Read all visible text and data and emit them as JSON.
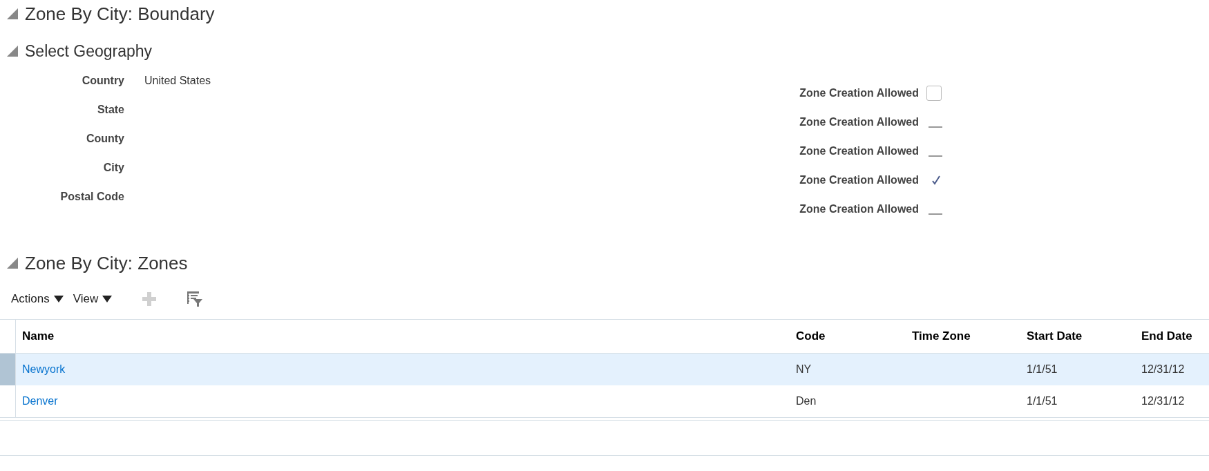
{
  "sections": [
    {
      "title": "Zone By City: Boundary",
      "expanded": true
    },
    {
      "title": "Select Geography",
      "expanded": true
    },
    {
      "title": "Zone By City: Zones",
      "expanded": true
    }
  ],
  "geography": {
    "fields": [
      {
        "label": "Country",
        "value": "United States"
      },
      {
        "label": "State"
      },
      {
        "label": "County"
      },
      {
        "label": "City"
      },
      {
        "label": "Postal Code"
      }
    ],
    "zone_flags": [
      {
        "label": "Zone Creation Allowed",
        "kind": "checkbox",
        "checked": false
      },
      {
        "label": "Zone Creation Allowed",
        "kind": "readonly",
        "checked": false
      },
      {
        "label": "Zone Creation Allowed",
        "kind": "readonly",
        "checked": false
      },
      {
        "label": "Zone Creation Allowed",
        "kind": "readonly",
        "checked": true
      },
      {
        "label": "Zone Creation Allowed",
        "kind": "readonly",
        "checked": false
      }
    ]
  },
  "toolbar": {
    "menus": [
      "Actions",
      "View"
    ],
    "add_disabled": true
  },
  "table": {
    "columns": [
      "Name",
      "Code",
      "Time Zone",
      "Start Date",
      "End Date"
    ],
    "rows": [
      {
        "selected": true,
        "cells": [
          "Newyork",
          "NY",
          "",
          "1/1/51",
          "12/31/12"
        ]
      },
      {
        "selected": false,
        "cells": [
          "Denver",
          "Den",
          "",
          "1/1/51",
          "12/31/12"
        ]
      }
    ]
  }
}
